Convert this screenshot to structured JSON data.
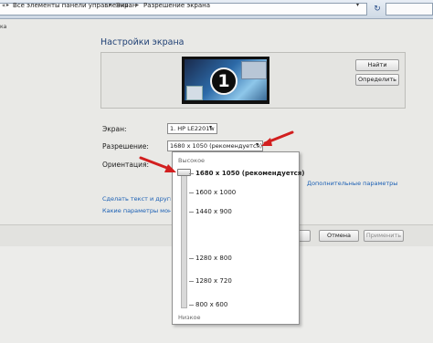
{
  "address_bar": {
    "root_label": "« ",
    "crumbs": [
      "Все элементы панели управления",
      "Экран",
      "Разрешение экрана"
    ],
    "cut_label": "ка"
  },
  "page": {
    "heading": "Настройки экрана",
    "monitor_number": "1",
    "find_button": "Найти",
    "identify_button": "Определить"
  },
  "settings": {
    "screen_label": "Экран:",
    "screen_value": "1. HP LE2201w",
    "resolution_label": "Разрешение:",
    "resolution_value": "1680 x 1050 (рекомендуется)",
    "orientation_label": "Ориентация:",
    "advanced_link": "Дополнительные параметры",
    "link_text_size": "Сделать текст и другие эл",
    "link_which_params": "Какие параметры монитор"
  },
  "footer": {
    "ok_label": "ОК",
    "cancel_label": "Отмена",
    "apply_label": "Применить"
  },
  "resolution_dropdown": {
    "high_label": "Высокое",
    "low_label": "Низкое",
    "options": [
      "1680 x 1050 (рекомендуется)",
      "1600 x 1000",
      "1440 x 900",
      "1280 x 800",
      "1280 x 720",
      "800 x 600"
    ],
    "selected": "1680 x 1050 (рекомендуется)"
  },
  "colors": {
    "heading": "#1e3f74",
    "link": "#1a5fb4",
    "annotation_arrow": "#d21f1f"
  }
}
